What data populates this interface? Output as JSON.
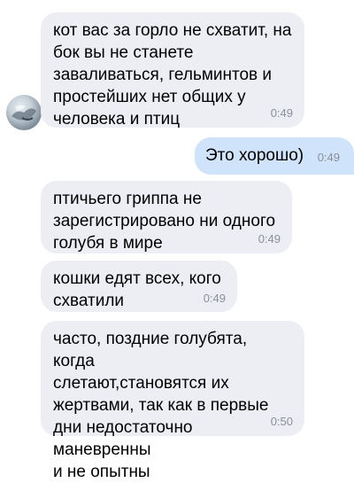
{
  "messages": [
    {
      "direction": "incoming",
      "text": "кот вас за горло не схватит, на\nбок вы не станете\nзаваливаться, гельминтов и\nпростейших нет общих у\nчеловека и птиц",
      "time": "0:49"
    },
    {
      "direction": "outgoing",
      "text": "Это хорошо)",
      "time": "0:49"
    },
    {
      "direction": "incoming",
      "text": "птичьего гриппа не\nзарегистрировано ни одного\nголубя в мире",
      "time": "0:49"
    },
    {
      "direction": "incoming",
      "text": "кошки едят всех, кого\nсхватили",
      "time": "0:49"
    },
    {
      "direction": "incoming",
      "text": "часто, поздние голубята, когда\nслетают,становятся их\nжертвами, так как в первые\nдни недостаточно маневренны\nи не опытны",
      "time": "0:50"
    }
  ],
  "avatar_icon": "contact-avatar-photo"
}
